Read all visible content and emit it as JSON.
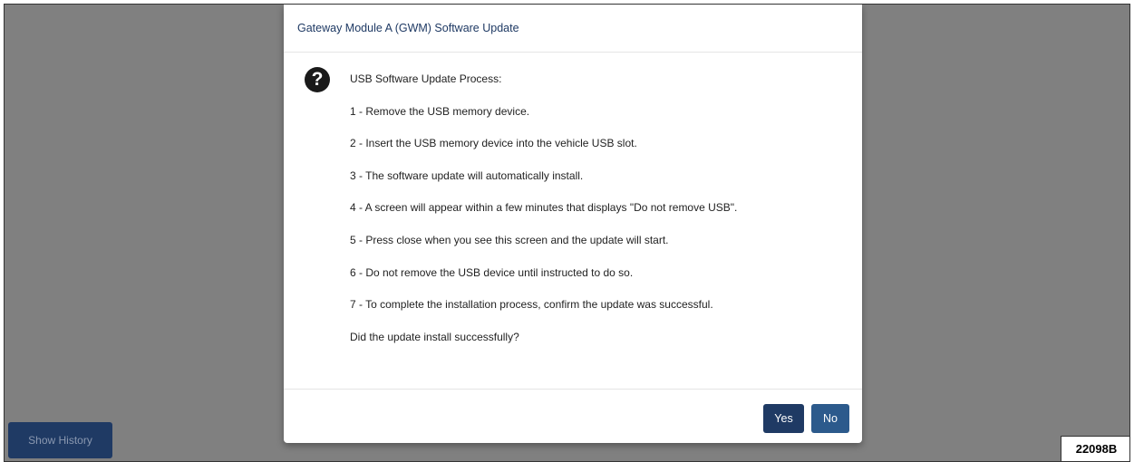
{
  "background": {
    "show_history_label": "Show History"
  },
  "dialog": {
    "title": "Gateway Module A (GWM) Software Update",
    "icon": "question-circle-icon",
    "heading": "USB Software Update Process:",
    "steps": [
      "1 - Remove the USB memory device.",
      "2 - Insert the USB memory device into the vehicle USB slot.",
      "3 - The software update will automatically install.",
      "4 - A screen will appear within a few minutes that displays \"Do not remove USB\".",
      "5 - Press close when you see this screen and the update will start.",
      "6 - Do not remove the USB device until instructed to do so.",
      "7 - To complete the installation process, confirm the update was successful."
    ],
    "question": "Did the update install successfully?",
    "buttons": {
      "yes": "Yes",
      "no": "No"
    }
  },
  "figure_ref": "22098B",
  "colors": {
    "overlay": "#808080",
    "primary": "#1f3a64",
    "primary_light": "#2c5a8c",
    "title_text": "#1f3a64"
  }
}
